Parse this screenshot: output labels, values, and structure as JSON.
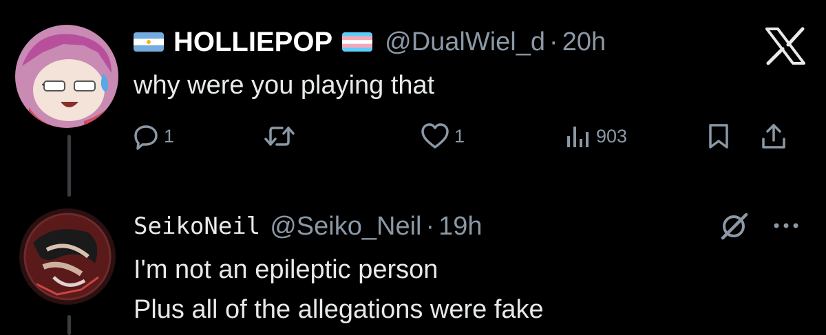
{
  "tweets": [
    {
      "display_name": "HOLLIEPOP",
      "handle": "@DualWiel_d",
      "separator": "·",
      "time": "20h",
      "text_lines": [
        "why were you playing that"
      ],
      "actions": {
        "replies": "1",
        "retweets": "",
        "likes": "1",
        "views": "903"
      }
    },
    {
      "display_name": "SeikoNeil",
      "handle": "@Seiko_Neil",
      "separator": "·",
      "time": "19h",
      "text_lines": [
        "I'm not an epileptic person",
        "Plus all of the allegations were fake"
      ]
    }
  ],
  "icons": {
    "flag_left": "argentina-flag-icon",
    "flag_right": "transgender-flag-icon",
    "close": "x-logo-icon",
    "reply": "reply-icon",
    "retweet": "retweet-icon",
    "like": "heart-icon",
    "views": "views-icon",
    "bookmark": "bookmark-icon",
    "share": "share-icon",
    "grok": "grok-icon",
    "more": "more-icon"
  },
  "colors": {
    "background": "#000000",
    "text_primary": "#e7e9ea",
    "text_secondary": "#8b98a5",
    "thread_line": "#3a3d40"
  }
}
